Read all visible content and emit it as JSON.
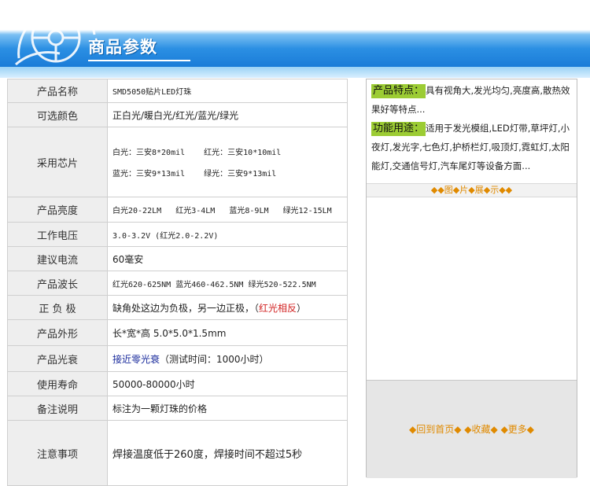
{
  "header": {
    "title": "商品参数",
    "colors": {
      "banner_blue": "#1a7cd8",
      "stripe_light": "#d9efff"
    },
    "icon": "film-reel-icon"
  },
  "specs": {
    "name": {
      "label": "产品名称",
      "value": "SMD5050贴片LED灯珠"
    },
    "colors_opt": {
      "label": "可选颜色",
      "value": "正白光/暖白光/红光/蓝光/绿光"
    },
    "chip": {
      "label": "采用芯片",
      "white": "白光：三安8*20mil",
      "red": "红光：三安10*10mil",
      "blue": "蓝光：三安9*13mil",
      "green": "绿光：三安9*13mil"
    },
    "brightness": {
      "label": "产品亮度",
      "white": "白光20-22LM",
      "red": "红光3-4LM",
      "blue": "蓝光8-9LM",
      "green": "绿光12-15LM"
    },
    "voltage": {
      "label": "工作电压",
      "value": "3.0-3.2V  (红光2.0-2.2V)"
    },
    "current": {
      "label": "建议电流",
      "value": "60毫安"
    },
    "wavelength": {
      "label": "产品波长",
      "value": "红光620-625NM  蓝光460-462.5NM  绿光520-522.5NM"
    },
    "polarity": {
      "label": "正 负 极",
      "value": "缺角处这边为负极，另一边正极，（",
      "highlight": "红光相反",
      "tail": "）"
    },
    "shape": {
      "label": "产品外形",
      "value": "长*宽*高 5.0*5.0*1.5mm"
    },
    "decay": {
      "label": "产品光衰",
      "highlight": "接近零光衰",
      "value": "（测试时间：1000小时）"
    },
    "life": {
      "label": "使用寿命",
      "value": "50000-80000小时"
    },
    "note": {
      "label": "备注说明",
      "value": "标注为一颗灯珠的价格"
    },
    "caution": {
      "label": "注意事项",
      "value": "焊接温度低于260度，焊接时间不超过5秒"
    }
  },
  "right": {
    "features_tag": "产品特点：",
    "features_text": "具有视角大,发光均匀,亮度高,散热效果好等特点...",
    "usage_tag": "功能用途：",
    "usage_text": "适用于发光模组,LED灯带,草坪灯,小夜灯,发光字,七色灯,护桥栏灯,吸顶灯,霓虹灯,太阳能灯,交通信号灯,汽车尾灯等设备方面...",
    "gallery_title": "◆◆图◆片◆展◆示◆◆",
    "links": {
      "home": "◆回到首页◆",
      "fav": "◆收藏◆",
      "more": "◆更多◆"
    },
    "colors": {
      "tag_green": "#9ccc34",
      "link_orange": "#e08a00"
    }
  }
}
